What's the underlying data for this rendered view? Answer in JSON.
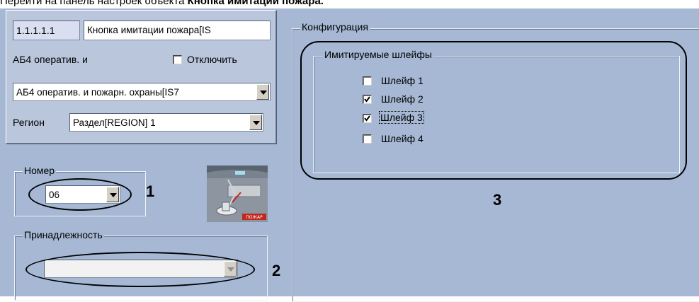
{
  "caption": {
    "text_plain": "Перейти на панель настроек объекта ",
    "text_bold": "Кнопка имитации пожара."
  },
  "object": {
    "id": "1.1.1.1.1",
    "name": "Кнопка имитации пожара[IS",
    "parent_label": "АБ4 оператив. и",
    "disable_label": "Отключить",
    "disable_checked": false,
    "parent_select": "АБ4 оператив. и пожарн. охраны[IS7",
    "region_label": "Регион",
    "region_select": "Раздел[REGION] 1"
  },
  "number_group": {
    "title": "Номер",
    "value": "06"
  },
  "membership_group": {
    "title": "Принадлежность",
    "value": ""
  },
  "config_group": {
    "title": "Конфигурация",
    "loops_title": "Имитируемые шлейфы",
    "loops": [
      {
        "label": "Шлейф 1",
        "checked": false
      },
      {
        "label": "Шлейф 2",
        "checked": true
      },
      {
        "label": "Шлейф 3",
        "checked": true
      },
      {
        "label": "Шлейф 4",
        "checked": false
      }
    ]
  },
  "icon_caption": "ПОЖАР",
  "markers": {
    "m1": "1",
    "m2": "2",
    "m3": "3"
  },
  "colors": {
    "panel_bg": "#a6b8d4",
    "group_bg": "#b9c6dc",
    "icon_red": "#c0281e"
  }
}
